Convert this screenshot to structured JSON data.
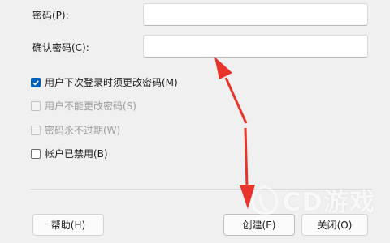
{
  "fields": {
    "password_label": "密码(P):",
    "confirm_label": "确认密码(C):"
  },
  "options": [
    {
      "label": "用户下次登录时须更改密码(M)",
      "checked": true,
      "disabled": false
    },
    {
      "label": "用户不能更改密码(S)",
      "checked": false,
      "disabled": true
    },
    {
      "label": "密码永不过期(W)",
      "checked": false,
      "disabled": true
    },
    {
      "label": "帐户已禁用(B)",
      "checked": false,
      "disabled": false
    }
  ],
  "buttons": {
    "help": "帮助(H)",
    "create": "创建(E)",
    "close": "关闭(O)"
  },
  "watermark": "CD游戏",
  "colors": {
    "accent": "#005fb8",
    "annotation_arrow": "#e8342a"
  }
}
